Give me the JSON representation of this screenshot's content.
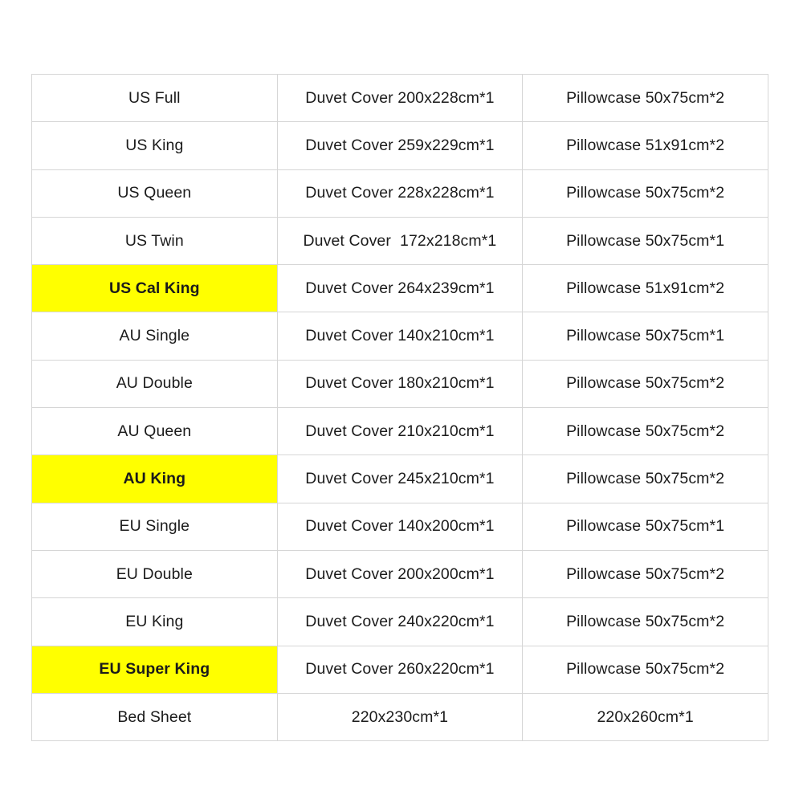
{
  "page": {
    "background_color": "#ffffff",
    "highlight_color": "#FFFF00",
    "border_color": "#d6d6d6",
    "text_color": "#1b1b1b"
  },
  "table": {
    "columns": 3,
    "rows": [
      {
        "size": "US Full",
        "duvet": "Duvet Cover 200x228cm*1",
        "pillow": "Pillowcase 50x75cm*2",
        "highlighted": false
      },
      {
        "size": "US King",
        "duvet": "Duvet Cover 259x229cm*1",
        "pillow": "Pillowcase 51x91cm*2",
        "highlighted": false
      },
      {
        "size": "US Queen",
        "duvet": "Duvet Cover 228x228cm*1",
        "pillow": "Pillowcase 50x75cm*2",
        "highlighted": false
      },
      {
        "size": "US Twin",
        "duvet": "Duvet Cover  172x218cm*1",
        "pillow": "Pillowcase 50x75cm*1",
        "highlighted": false
      },
      {
        "size": "US Cal King",
        "duvet": "Duvet Cover 264x239cm*1",
        "pillow": "Pillowcase 51x91cm*2",
        "highlighted": true
      },
      {
        "size": "AU Single",
        "duvet": "Duvet Cover 140x210cm*1",
        "pillow": "Pillowcase 50x75cm*1",
        "highlighted": false
      },
      {
        "size": "AU Double",
        "duvet": "Duvet Cover 180x210cm*1",
        "pillow": "Pillowcase 50x75cm*2",
        "highlighted": false
      },
      {
        "size": "AU Queen",
        "duvet": "Duvet Cover 210x210cm*1",
        "pillow": "Pillowcase 50x75cm*2",
        "highlighted": false
      },
      {
        "size": "AU King",
        "duvet": "Duvet Cover 245x210cm*1",
        "pillow": "Pillowcase 50x75cm*2",
        "highlighted": true
      },
      {
        "size": "EU Single",
        "duvet": "Duvet Cover 140x200cm*1",
        "pillow": "Pillowcase 50x75cm*1",
        "highlighted": false
      },
      {
        "size": "EU Double",
        "duvet": "Duvet Cover 200x200cm*1",
        "pillow": "Pillowcase 50x75cm*2",
        "highlighted": false
      },
      {
        "size": "EU King",
        "duvet": "Duvet Cover 240x220cm*1",
        "pillow": "Pillowcase 50x75cm*2",
        "highlighted": false
      },
      {
        "size": "EU Super King",
        "duvet": "Duvet Cover 260x220cm*1",
        "pillow": "Pillowcase 50x75cm*2",
        "highlighted": true
      },
      {
        "size": "Bed Sheet",
        "duvet": "220x230cm*1",
        "pillow": "220x260cm*1",
        "highlighted": false
      }
    ]
  }
}
